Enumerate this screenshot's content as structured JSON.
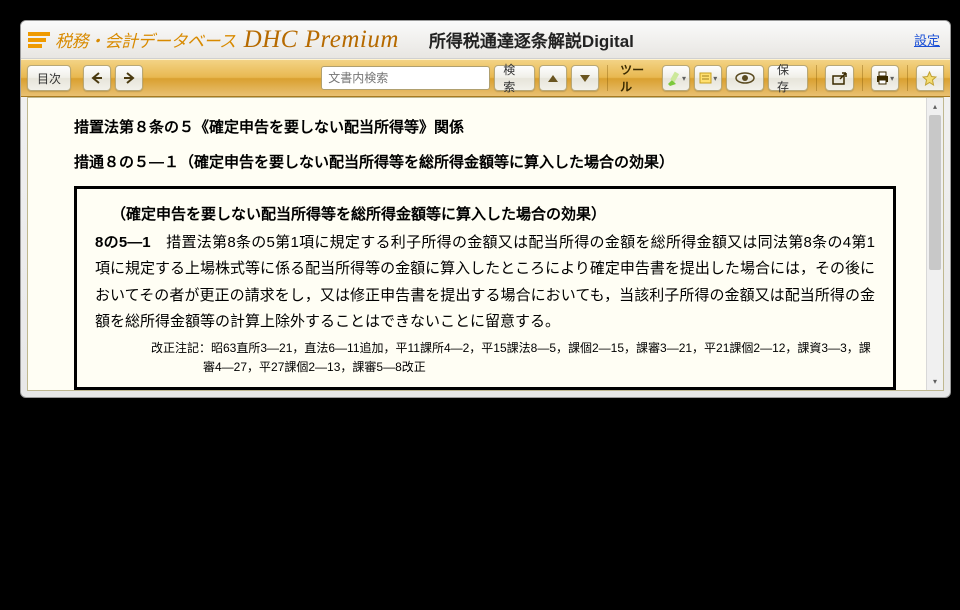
{
  "header": {
    "brand_tax": "税務・会計データベース",
    "brand_premium": "DHC Premium",
    "page_title": "所得税通達逐条解説Digital",
    "settings": "設定"
  },
  "toolbar": {
    "toc": "目次",
    "search_placeholder": "文書内検索",
    "search_btn": "検索",
    "tools": "ツール",
    "save": "保存"
  },
  "content": {
    "heading1": "措置法第８条の５《確定申告を要しない配当所得等》関係",
    "heading2": "措通８の５―１（確定申告を要しない配当所得等を総所得金額等に算入した場合の効果）",
    "box_title": "（確定申告を要しない配当所得等を総所得金額等に算入した場合の効果）",
    "box_num": "8の5―1",
    "box_body": "　措置法第8条の5第1項に規定する利子所得の金額又は配当所得の金額を総所得金額又は同法第8条の4第1項に規定する上場株式等に係る配当所得等の金額に算入したところにより確定申告書を提出した場合には，その後においてその者が更正の請求をし，又は修正申告書を提出する場合においても，当該利子所得の金額又は配当所得の金額を総所得金額等の計算上除外することはできないことに留意する。",
    "revision": "改正注記：昭63直所3―21，直法6―11追加，平11課所4―2，平15課法8―5，課個2―15，課審3―21，平21課個2―12，課資3―3，課審4―27，平27課個2―13，課審5―8改正"
  }
}
